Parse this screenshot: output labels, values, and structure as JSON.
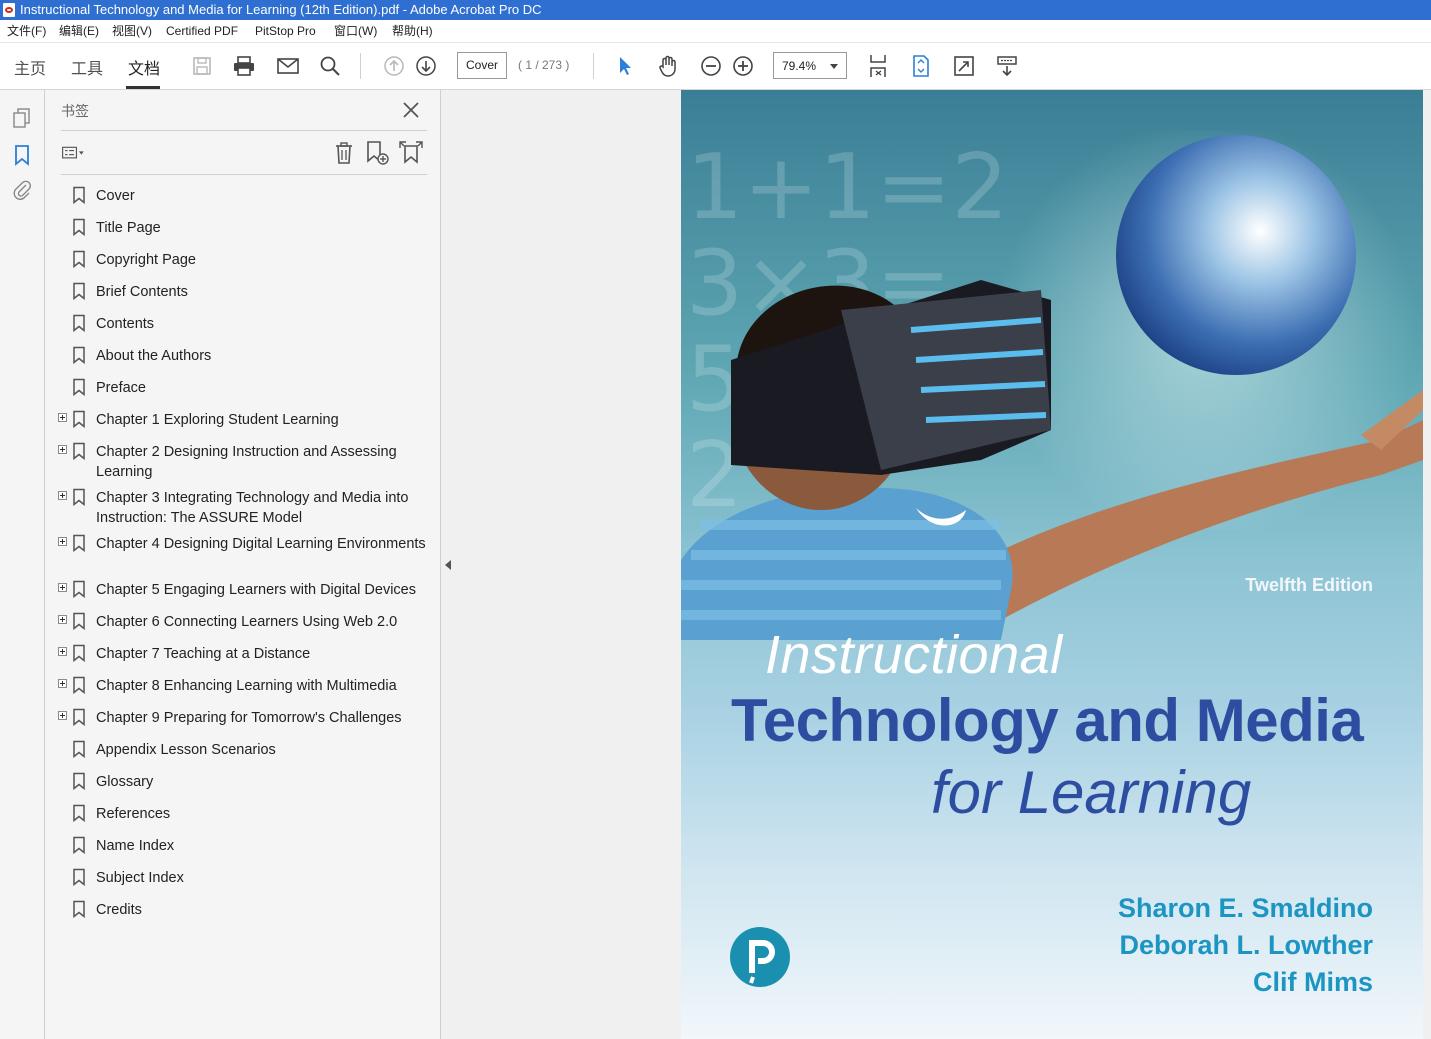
{
  "window": {
    "title": "Instructional Technology and Media for Learning (12th Edition).pdf - Adobe Acrobat Pro DC"
  },
  "menu": [
    "文件(F)",
    "编辑(E)",
    "视图(V)",
    "Certified PDF",
    "PitStop Pro",
    "窗口(W)",
    "帮助(H)"
  ],
  "toolbar": {
    "tabs": [
      "主页",
      "工具",
      "文档"
    ],
    "active_tab": "文档",
    "page_label": "Cover",
    "page_count": "( 1 / 273 )",
    "zoom": "79.4%"
  },
  "panel": {
    "title": "书签",
    "bookmarks": [
      {
        "label": "Cover",
        "expandable": false
      },
      {
        "label": "Title Page",
        "expandable": false
      },
      {
        "label": "Copyright Page",
        "expandable": false
      },
      {
        "label": "Brief Contents",
        "expandable": false
      },
      {
        "label": "Contents",
        "expandable": false
      },
      {
        "label": "About the Authors",
        "expandable": false
      },
      {
        "label": "Preface",
        "expandable": false
      },
      {
        "label": "Chapter 1 Exploring Student Learning",
        "expandable": true
      },
      {
        "label": "Chapter 2 Designing Instruction and Assessing Learning",
        "expandable": true
      },
      {
        "label": "Chapter 3 Integrating Technology and Media into Instruction: The ASSURE Model",
        "expandable": true
      },
      {
        "label": "Chapter 4 Designing Digital Learning Environments",
        "expandable": true
      },
      {
        "label": "Chapter 5 Engaging Learners with Digital Devices",
        "expandable": true
      },
      {
        "label": "Chapter 6 Connecting Learners Using Web 2.0",
        "expandable": true
      },
      {
        "label": "Chapter 7 Teaching at a Distance",
        "expandable": true
      },
      {
        "label": "Chapter 8 Enhancing Learning with Multimedia",
        "expandable": true
      },
      {
        "label": "Chapter 9 Preparing for Tomorrow's Challenges",
        "expandable": true
      },
      {
        "label": "Appendix Lesson Scenarios",
        "expandable": false
      },
      {
        "label": "Glossary",
        "expandable": false
      },
      {
        "label": "References",
        "expandable": false
      },
      {
        "label": "Name Index",
        "expandable": false
      },
      {
        "label": "Subject Index",
        "expandable": false
      },
      {
        "label": "Credits",
        "expandable": false
      }
    ]
  },
  "cover": {
    "edition": "Twelfth Edition",
    "title_line1": "Instructional",
    "title_line2": "Technology and Media",
    "title_line3": "for Learning",
    "authors": [
      "Sharon E. Smaldino",
      "Deborah L. Lowther",
      "Clif Mims"
    ]
  },
  "colors": {
    "titlebar": "#2f6fd1",
    "accent_blue": "#2d7fd8",
    "cover_title_blue": "#2d4ea0",
    "cover_author_blue": "#1d95c2",
    "pearson_teal": "#1a8fb0"
  }
}
